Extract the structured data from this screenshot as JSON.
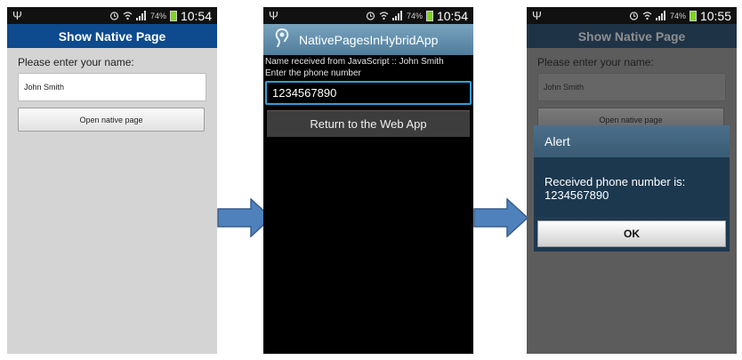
{
  "colors": {
    "web_title_bg": "#0d4a8e",
    "native_action_bar": "#4f7d9d",
    "arrow": "#4f81bd"
  },
  "status_bar": {
    "usb_icon": "Ψ",
    "battery_pct": "74%",
    "time_1": "10:54",
    "time_2": "10:54",
    "time_3": "10:55"
  },
  "web_page": {
    "title": "Show Native Page",
    "name_label": "Please enter your name:",
    "name_value": "John Smith",
    "open_button": "Open native page"
  },
  "native_page": {
    "app_title": "NativePagesInHybridApp",
    "received_text": "Name received from JavaScript :: John Smith",
    "phone_label": "Enter the phone number",
    "phone_value": "1234567890",
    "return_button": "Return to the Web App"
  },
  "alert": {
    "title": "Alert",
    "message": "Received phone number is: 1234567890",
    "ok_button": "OK"
  }
}
